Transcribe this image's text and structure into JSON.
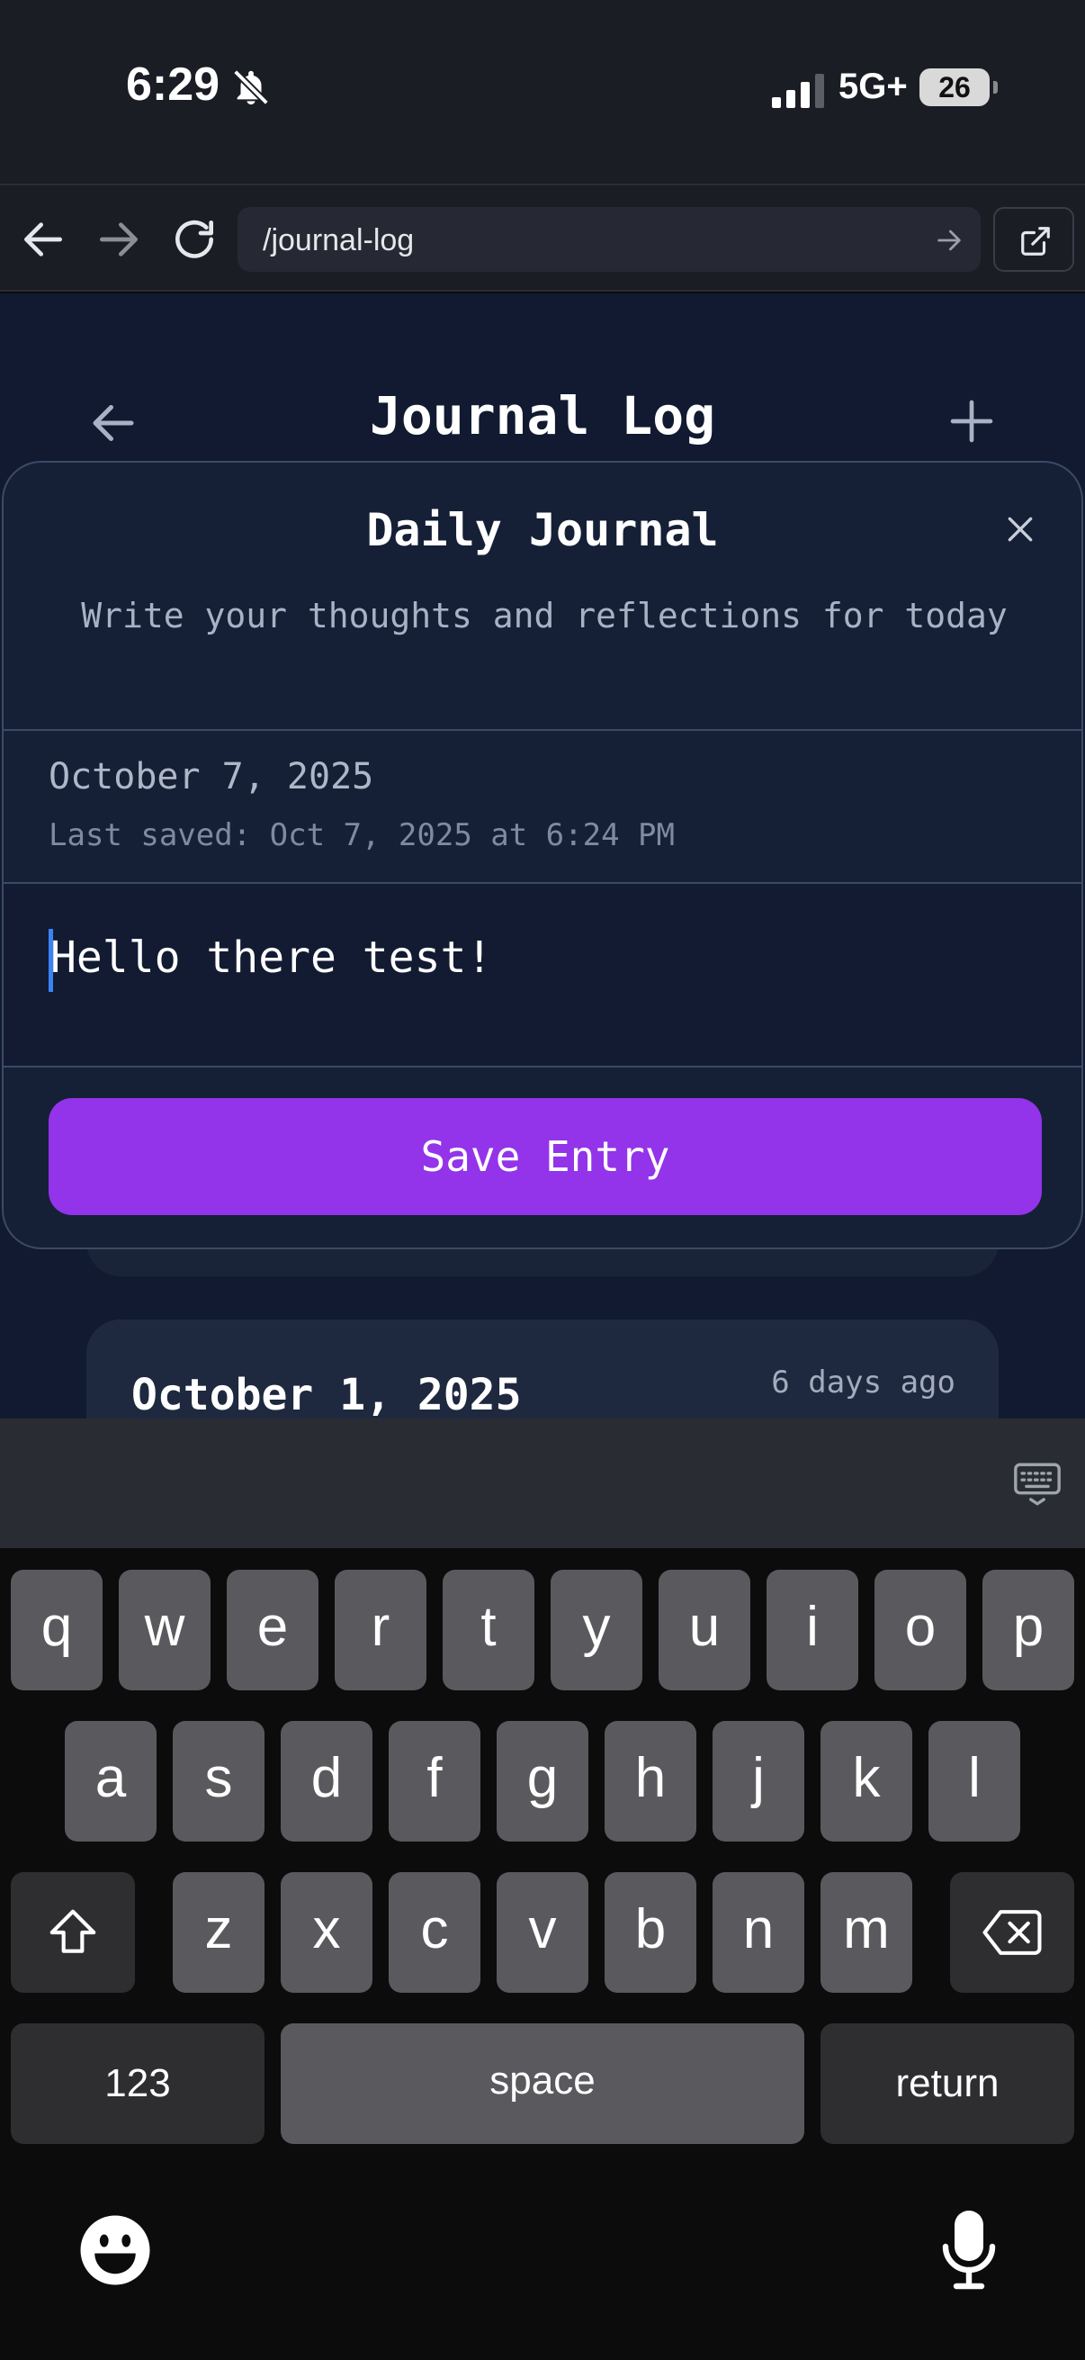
{
  "status_bar": {
    "time": "6:29",
    "network": "5G+",
    "battery": "26"
  },
  "browser": {
    "url": "/journal-log"
  },
  "app": {
    "title": "Journal Log",
    "entry": {
      "date": "October 1, 2025",
      "ago": "6 days ago"
    }
  },
  "modal": {
    "title": "Daily Journal",
    "subtitle": "Write your thoughts and reflections for today",
    "date": "October 7, 2025",
    "last_saved": "Last saved: Oct 7, 2025 at 6:24 PM",
    "entry_text": "Hello there test!",
    "save_label": "Save Entry"
  },
  "keyboard": {
    "row1": [
      "q",
      "w",
      "e",
      "r",
      "t",
      "y",
      "u",
      "i",
      "o",
      "p"
    ],
    "row2": [
      "a",
      "s",
      "d",
      "f",
      "g",
      "h",
      "j",
      "k",
      "l"
    ],
    "row3": [
      "z",
      "x",
      "c",
      "v",
      "b",
      "n",
      "m"
    ],
    "numbers_label": "123",
    "space_label": "space",
    "return_label": "return"
  },
  "colors": {
    "accent": "#9333ea",
    "caret": "#3b82f6",
    "app_bg": "#111a30"
  }
}
